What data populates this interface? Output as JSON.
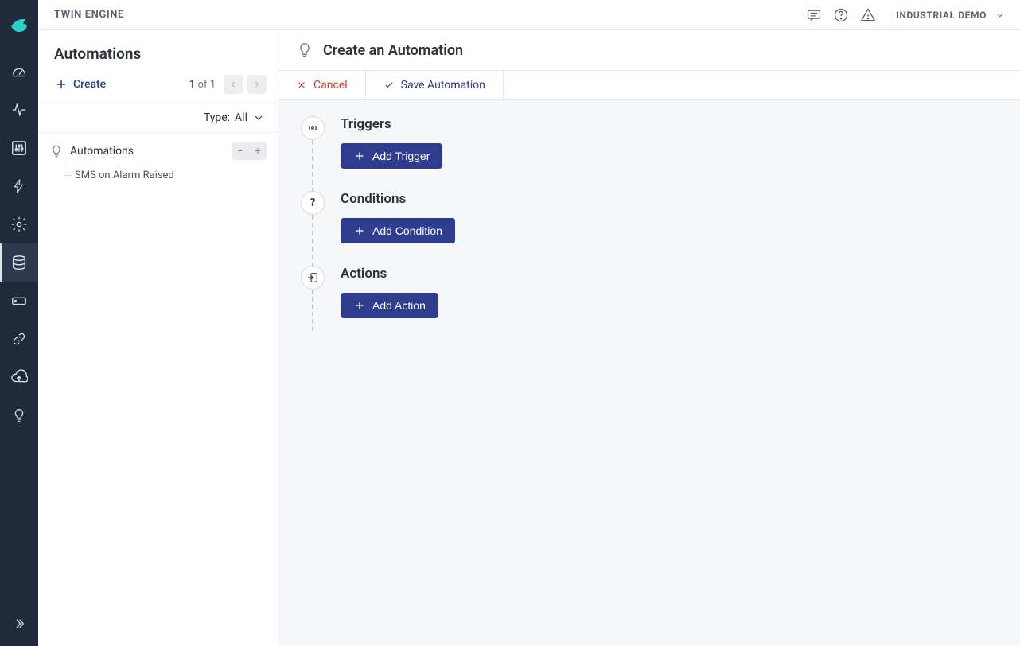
{
  "topbar": {
    "app_title": "TWIN ENGINE",
    "user_label": "INDUSTRIAL DEMO"
  },
  "sidebar": {
    "title": "Automations",
    "create_label": "Create",
    "pager": {
      "current": "1",
      "of_label": "of",
      "total": "1"
    },
    "type_filter": {
      "prefix": "Type:",
      "value": "All"
    },
    "tree": {
      "root_label": "Automations",
      "children": [
        {
          "label": "SMS on Alarm Raised"
        }
      ]
    }
  },
  "editor": {
    "title": "Create an Automation",
    "cancel_label": "Cancel",
    "save_label": "Save Automation",
    "stages": {
      "triggers": {
        "title": "Triggers",
        "add_label": "Add Trigger"
      },
      "conditions": {
        "title": "Conditions",
        "add_label": "Add Condition"
      },
      "actions": {
        "title": "Actions",
        "add_label": "Add Action"
      }
    }
  }
}
